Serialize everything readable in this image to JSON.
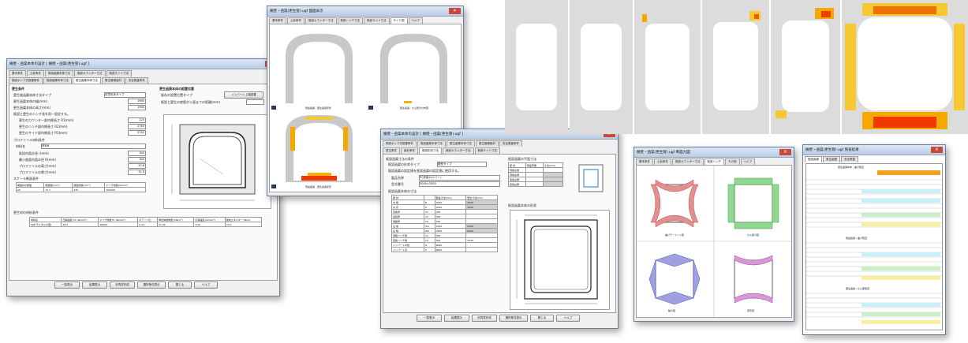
{
  "win1": {
    "title": "擁壁 - 函渠本体の設計 [ 擁壁・函渠(更生管).ugf ]",
    "tabs": [
      "基本条件",
      "土砂条件",
      "既設函渠本体寸法",
      "既設カウンター寸法",
      "既設サイド寸法"
    ],
    "tabs2": [
      "既設ポンプ式設置条件",
      "既設函渠本体寸法",
      "更生函渠本体寸法",
      "更生管補強材",
      "安全照査条件"
    ],
    "section1": "更生条件",
    "rows": [
      {
        "label": "更生後函渠本体寸法タイプ",
        "value": "任意形状タイプ"
      },
      {
        "label": "更生函渠本体の幅(mm)",
        "value": "1980"
      },
      {
        "label": "更生函渠本体の高さ(mm)",
        "value": "1980"
      }
    ],
    "check1": "既設と更生のハンチ長を同一設定する。",
    "sub_rows": [
      {
        "label": "更生のカウンター部内側長さ R1(mm)",
        "value": "225"
      },
      {
        "label": "更生のハンチ部内側長さ R2(mm)",
        "value": "2760"
      },
      {
        "label": "更生のサイド部内側長さ R3(mm)",
        "value": "2760"
      }
    ],
    "right_section": "更生函渠本体の設置位置",
    "right_row1": "既存の設置位置タイプ",
    "right_btn": "インバート上端設置",
    "right_row2": "既設と更生の底版から面までの距離(mm)",
    "profile_title": "プロファイル材料条件",
    "profile_name_label": "材料名",
    "profile_name_value": "材料B",
    "profile_rows": [
      {
        "label": "既設内面半径 r(mm)",
        "value": "300"
      },
      {
        "label": "最小曲面内面半径 R(mm)",
        "value": "300"
      },
      {
        "label": "プロファイルの高さ(mm)",
        "value": "20.6"
      },
      {
        "label": "プロファイルの厚さ(mm)",
        "value": "31.5"
      }
    ],
    "scale_title": "スケール断面条件",
    "scale_headers": [
      "補強材の断面",
      "断面積(mm²)",
      "断面係数(mm³)",
      "ヤング係数(N/mm²)"
    ],
    "scale_values": [
      "20",
      "72.7",
      "335",
      "195000"
    ],
    "material_title": "更生材の材料条件",
    "mat_headers": [
      "材料名",
      "圧縮強度 fck (N/mm²)",
      "ヤング係数 Ec (N/mm²)",
      "ポアソン比",
      "単位体積重量 (kN/m³)",
      "引張強度 (N/mm²)",
      "破壊エネルギー (N/m)"
    ],
    "mat_values": [
      "SPR モルタル(U型)",
      "28.0",
      "18000",
      "0.24",
      "21.00",
      "3.00",
      "70.0"
    ],
    "buttons": [
      "一覧表示",
      "結果表示",
      "計算書作成",
      "選択条件表示",
      "閉じる",
      "ヘルプ"
    ]
  },
  "win2": {
    "title": "擁壁・函渠(更生管).ugf 図面表示",
    "tabs": [
      "基本条件",
      "土砂条件",
      "既設カウンター寸法",
      "既設ハンチ寸法",
      "既設サイド寸法",
      "サイド図",
      "ヘルプ"
    ],
    "captions": [
      "既設函渠 - 更生函渠形状",
      "更生函渠 - せん断力分布図",
      "既設函渠 - 更生函渠変形"
    ]
  },
  "win3": {
    "title": "擁壁 - 函渠本体の設計 [ 擁壁・函渠(更生管).ugf ]",
    "tabs": [
      "既設ポンプ式設置条件",
      "既設函渠本体寸法",
      "更生函渠本体寸法",
      "更生管補強材",
      "安全照査条件"
    ],
    "tabs2": [
      "更生条件",
      "設計条件",
      "既設形状寸法",
      "既設カウンター寸法",
      "既設サイド寸法"
    ],
    "shape_title": "既設函渠寸法の条件",
    "shape_type_label": "既設函渠の形状タイプ",
    "shape_type_value": "箱型タイプ",
    "check": "既設函渠の設定値を既設函渠の設定値に使用する。",
    "rows": [
      {
        "label": "製品名称",
        "value": "PC床版カルバート"
      },
      {
        "label": "型式番号",
        "value": "3000×3000"
      }
    ],
    "dim_title": "既設函渠本体の寸法",
    "dim_headers": [
      "部 材",
      "",
      "既設寸法(mm)",
      "更生寸法(mm)"
    ],
    "dim_rows": [
      [
        "内 幅",
        "B",
        "3000",
        "3000"
      ],
      [
        "内 高",
        "H",
        "3000",
        "3000"
      ],
      [
        "頂版厚",
        "T1",
        "300",
        ""
      ],
      [
        "底版厚",
        "T2",
        "300",
        ""
      ],
      [
        "側壁厚",
        "T3",
        "250",
        ""
      ],
      [
        "左 幅",
        "W1",
        "2500",
        "2500"
      ],
      [
        "右 幅",
        "W2",
        "2500",
        "2500"
      ],
      [
        "頂版ハンチ幅",
        "h1",
        "300",
        ""
      ],
      [
        "底版ハンチ幅",
        "h2",
        "300",
        "2476"
      ],
      [
        "インバート半径",
        "R",
        "8000",
        ""
      ],
      [
        "インバート高",
        "h",
        "8000",
        ""
      ]
    ],
    "hunch_title": "既設函渠の平面寸法",
    "hunch_headers": [
      "部 材",
      "既設有無",
      "寸法(mm)"
    ],
    "hunch_rows": [
      "頂版左側",
      "頂版右側",
      "底版左側",
      "底版右側"
    ],
    "figure_title": "既設函渠本体の形状",
    "buttons": [
      "一覧表示",
      "結果表示",
      "計算書作成",
      "選択条件表示",
      "閉じる",
      "ヘルプ"
    ]
  },
  "win4": {
    "title": "擁壁・函渠(更生管).ugf 断面力図",
    "tabs": [
      "基本条件",
      "土砂条件",
      "既設カウンター寸法",
      "既設ハンチ",
      "その他",
      "ヘルプ"
    ],
    "captions": [
      "曲げモーメント図",
      "せん断力図",
      "軸力図",
      "変形図"
    ]
  },
  "win5": {
    "title": "擁壁・函渠(更生管).ugf 照査結果",
    "tabs": [
      "既設函渠",
      "更生函渠",
      "安全照査"
    ],
    "section_titles": [
      "更生函渠本体 - 曲げ照査",
      "既設函渠 - 曲げ照査",
      "更生函渠 - せん断照査"
    ]
  },
  "heatmap_count": 6
}
